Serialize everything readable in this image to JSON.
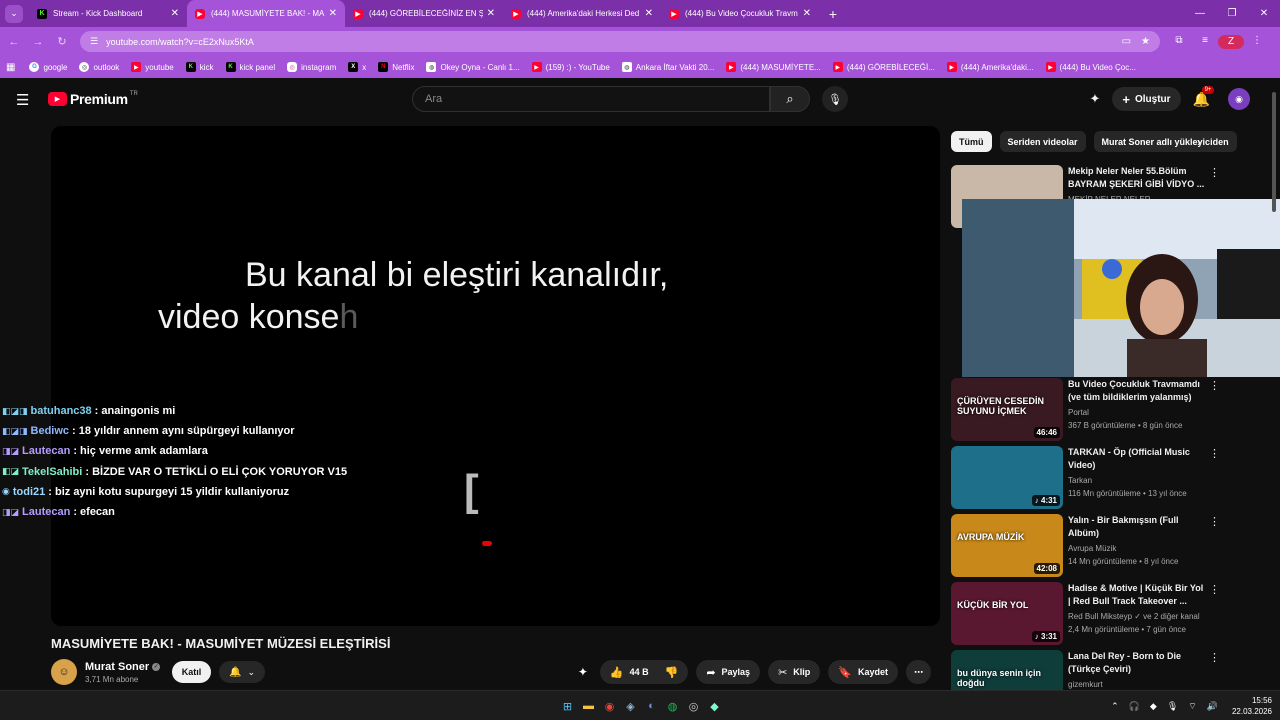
{
  "browser": {
    "tabs": [
      {
        "title": "Stream - Kick Dashboard",
        "icon": "kick-icon",
        "active": false
      },
      {
        "title": "(444) MASUMİYETE BAK! - MA",
        "icon": "youtube-icon",
        "active": true
      },
      {
        "title": "(444) GÖREBİLECEĞİNİZ EN ŞEY",
        "icon": "youtube-icon",
        "active": false
      },
      {
        "title": "(444) Amerika'daki Herkesi Ded",
        "icon": "youtube-icon",
        "active": false
      },
      {
        "title": "(444) Bu Video Çocukluk Travm",
        "icon": "youtube-icon",
        "active": false
      }
    ],
    "url": "youtube.com/watch?v=cE2xNux5KtA",
    "profile_initial": "Z",
    "bookmarks": [
      {
        "label": "google",
        "icon": "google-icon"
      },
      {
        "label": "outlook",
        "icon": "outlook-icon"
      },
      {
        "label": "youtube",
        "icon": "youtube-icon"
      },
      {
        "label": "kick",
        "icon": "kick-icon"
      },
      {
        "label": "kick panel",
        "icon": "kick-icon"
      },
      {
        "label": "instagram",
        "icon": "instagram-icon"
      },
      {
        "label": "x",
        "icon": "x-icon"
      },
      {
        "label": "Netflix",
        "icon": "netflix-icon"
      },
      {
        "label": "Okey Oyna - Canlı 1...",
        "icon": "globe-icon"
      },
      {
        "label": "(159) :) - YouTube",
        "icon": "youtube-icon"
      },
      {
        "label": "Ankara İftar Vakti 20...",
        "icon": "globe-icon"
      },
      {
        "label": "(444) MASUMİYETE...",
        "icon": "youtube-icon"
      },
      {
        "label": "(444) GÖREBİLECEĞİ...",
        "icon": "youtube-icon"
      },
      {
        "label": "(444) Amerika'daki...",
        "icon": "youtube-icon"
      },
      {
        "label": "(444) Bu Video Çoc...",
        "icon": "youtube-icon"
      }
    ]
  },
  "youtube": {
    "logo_text": "Premium",
    "region": "TR",
    "search_placeholder": "Ara",
    "create_label": "Oluştur",
    "notif_badge": "9+"
  },
  "player": {
    "subtitle_line1": "Bu kanal bi eleştiri kanalıdır,",
    "subtitle_line2_main": "video konse",
    "subtitle_line2_fade": "h",
    "bracket_glyph": "["
  },
  "chat": [
    {
      "user": "batuhanc38",
      "text": ": anaingonis mi",
      "color": "#7fd1f2",
      "badges": "◧◪◨"
    },
    {
      "user": "Bediwc",
      "text": ": 18 yıldır annem aynı süpürgeyi kullanıyor",
      "color": "#8fb8ff",
      "badges": "◧◪◨"
    },
    {
      "user": "Lautecan",
      "text": ": hiç verme amk adamlara",
      "color": "#b59cff",
      "badges": "◨◪"
    },
    {
      "user": "TekelSahibi",
      "text": ": BİZDE VAR O TETİKLİ O ELİ ÇOK YORUYOR V15",
      "color": "#7ef0c9",
      "badges": "◧◪"
    },
    {
      "user": "todi21",
      "text": ": biz ayni kotu supurgeyi 15 yildir kullaniyoruz",
      "color": "#9ad8ff",
      "badges": "◉"
    },
    {
      "user": "Lautecan",
      "text": ": efecan",
      "color": "#b59cff",
      "badges": "◨◪"
    }
  ],
  "video": {
    "title": "MASUMİYETE BAK! - MASUMİYET MÜZESİ ELEŞTİRİSİ",
    "channel_name": "Murat Soner",
    "subscribers": "3,71 Mn abone",
    "join_label": "Katıl",
    "likes": "44 B",
    "share_label": "Paylaş",
    "clip_label": "Klip",
    "save_label": "Kaydet"
  },
  "chips": [
    "Tümü",
    "Seriden videolar",
    "Murat Soner adlı yükleyiciden"
  ],
  "recommendations": [
    {
      "title": "Mekip Neler Neler 55.Bölüm BAYRAM ŞEKERİ GİBİ VİDYO ...",
      "channel": "MEKİP NELER NELER",
      "meta": "",
      "duration": "",
      "thumb": "#c9b8a7"
    },
    {
      "title": "Bu Video Çocukluk Travmamdı (ve tüm bildiklerim yalanmış)",
      "channel": "Portal",
      "meta": "367 B görüntüleme • 8 gün önce",
      "duration": "46:46",
      "thumb": "#3a1a22",
      "thumb_text": "ÇÜRÜYEN CESEDİN SUYUNU İÇMEK"
    },
    {
      "title": "TARKAN - Öp (Official Music Video)",
      "channel": "Tarkan",
      "meta": "116 Mn görüntüleme • 13 yıl önce",
      "duration": "♪ 4:31",
      "thumb": "#1e6f8a"
    },
    {
      "title": "Yalın - Bir Bakmışsın (Full Albüm)",
      "channel": "Avrupa Müzik",
      "meta": "14 Mn görüntüleme • 8 yıl önce",
      "duration": "42:08",
      "thumb": "#c9891a",
      "thumb_text": "AVRUPA MÜZİK"
    },
    {
      "title": "Hadise & Motive | Küçük Bir Yol | Red Bull Track Takeover ...",
      "channel": "Red Bull Mikstеyp ✓ ve 2 diğer kanal",
      "meta": "2,4 Mn görüntüleme • 7 gün önce",
      "duration": "♪ 3:31",
      "thumb": "#5a1830",
      "thumb_text": "KÜÇÜK BİR YOL"
    },
    {
      "title": "Lana Del Rey - Born to Die (Türkçe Çeviri)",
      "channel": "gizemkurt",
      "meta": "",
      "duration": "",
      "thumb": "#0f3d3a",
      "thumb_text": "bu dünya senin için doğdu"
    }
  ],
  "taskbar": {
    "time": "15:56",
    "date": "22.03.2026",
    "icons": [
      "windows-icon",
      "file-explorer-icon",
      "chrome-icon",
      "steam-icon",
      "discord-icon",
      "spotify-icon",
      "obs-icon",
      "streamlabs-icon"
    ]
  }
}
